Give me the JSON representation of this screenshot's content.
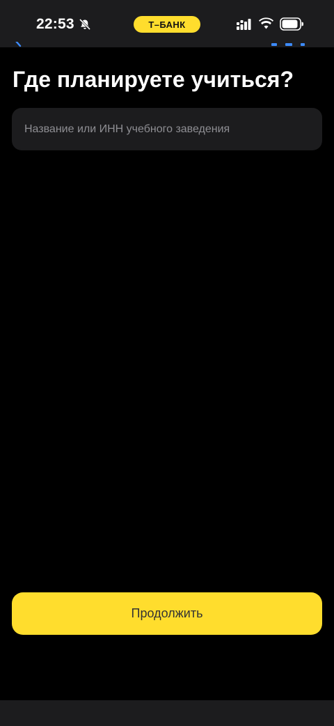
{
  "status_bar": {
    "time": "22:53",
    "bell_icon": "bell-slash-icon",
    "brand": "Т–БАНК",
    "brand_color": "#ffdd2d",
    "signal_icon": "cellular-signal-icon",
    "wifi_icon": "wifi-icon",
    "battery_icon": "battery-icon",
    "battery_level": 0.85
  },
  "header": {
    "back_icon": "chevron-left-icon"
  },
  "page": {
    "title": "Где планируете учиться?"
  },
  "search": {
    "placeholder": "Название или ИНН учебного заведения",
    "value": ""
  },
  "footer": {
    "continue_label": "Продолжить",
    "accent_color": "#ffdd2d"
  },
  "colors": {
    "background": "#000000",
    "surface": "#1c1c1e",
    "accent": "#ffdd2d",
    "placeholder": "#8e8e93"
  }
}
